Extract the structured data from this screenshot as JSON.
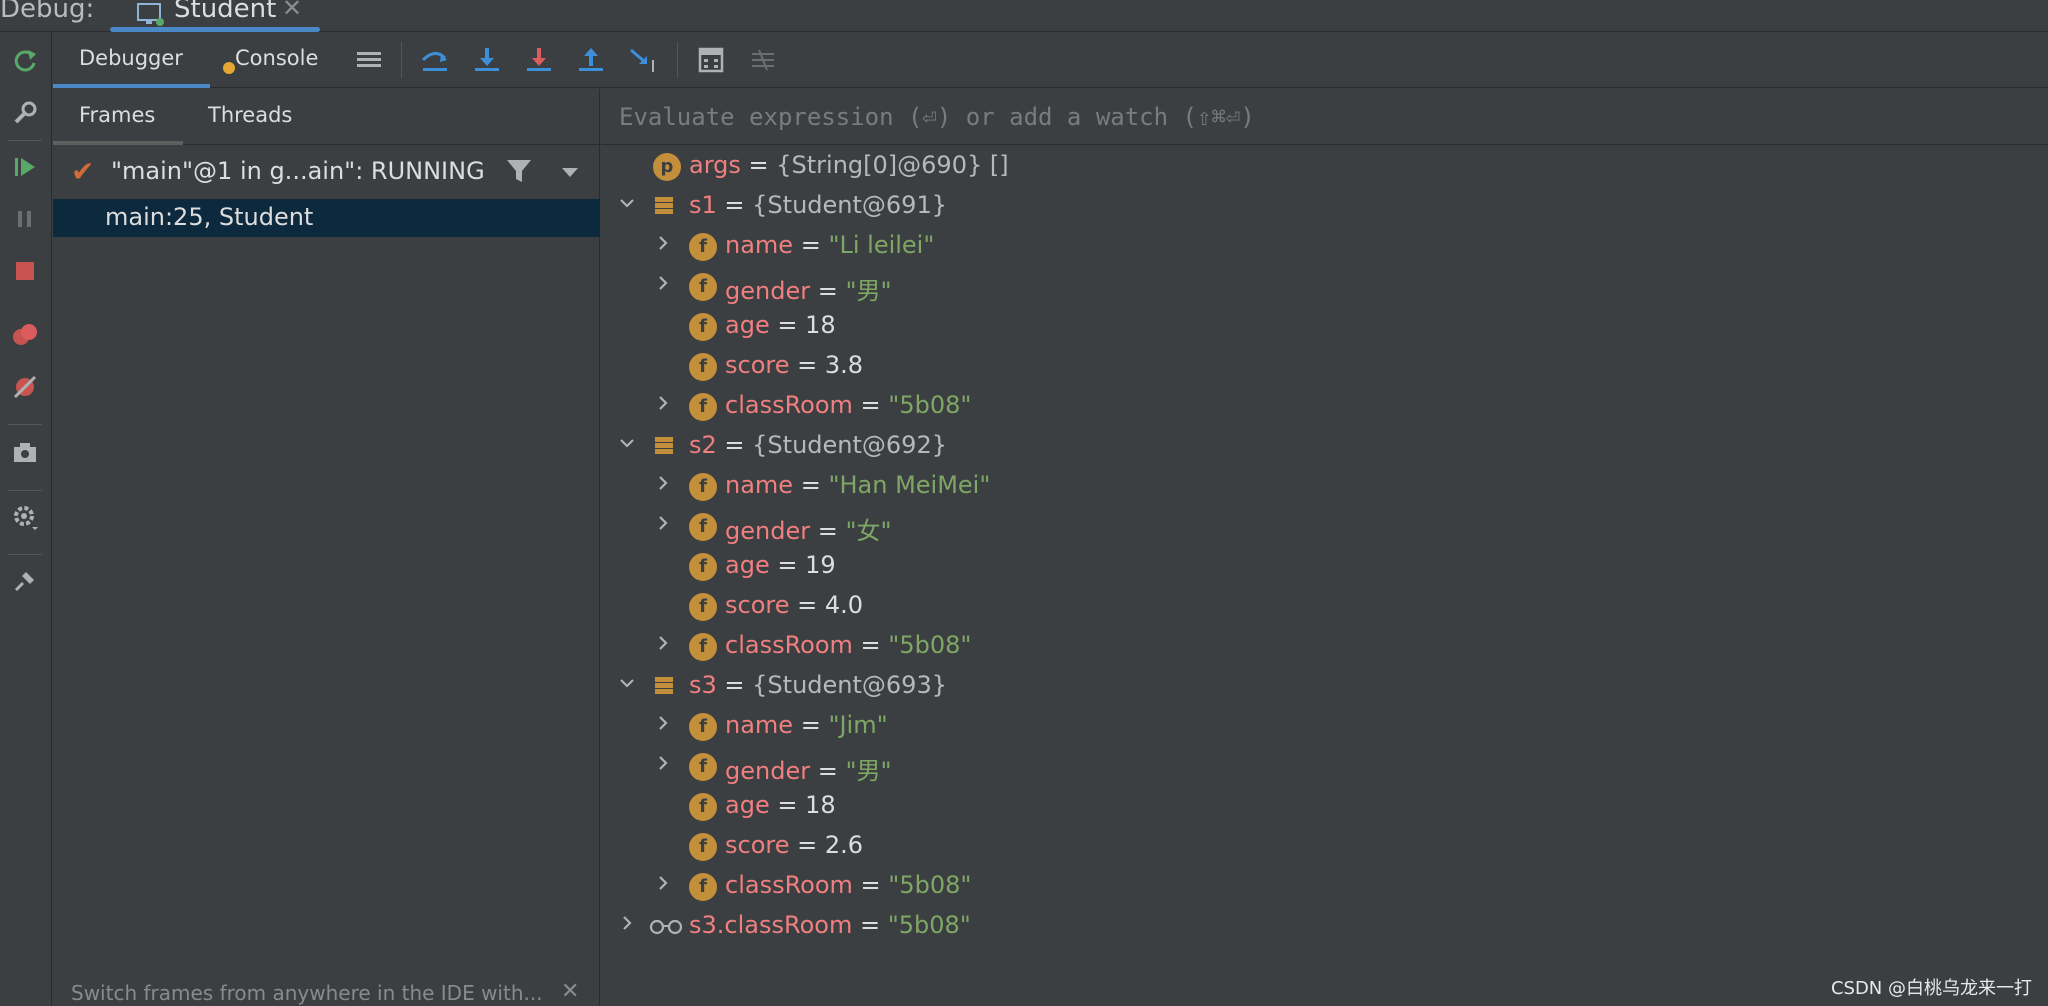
{
  "titlebar": {
    "label": "Debug:",
    "tab_name": "Student",
    "tab_close": "✕"
  },
  "tabstrip": {
    "debugger_label": "Debugger",
    "console_label": "Console"
  },
  "frames": {
    "tabs": [
      "Frames",
      "Threads"
    ],
    "thread_text": "\"main\"@1 in g...ain\": RUNNING",
    "frame": "main:25, Student",
    "hint": "Switch frames from anywhere in the IDE with...",
    "hint_close": "✕"
  },
  "eval": {
    "placeholder": "Evaluate expression (⏎) or add a watch (⇧⌘⏎)"
  },
  "variables": [
    {
      "name": "args",
      "value": "{String[0]@690} []",
      "kind": "param",
      "badge": "p"
    },
    {
      "name": "s1",
      "value": "{Student@691}",
      "kind": "object"
    },
    {
      "name": "name",
      "value": "\"Li leilei\"",
      "kind": "field",
      "badge": "f"
    },
    {
      "name": "gender",
      "value": "\"男\"",
      "kind": "field",
      "badge": "f"
    },
    {
      "name": "age",
      "value": "18",
      "kind": "field",
      "badge": "f"
    },
    {
      "name": "score",
      "value": "3.8",
      "kind": "field",
      "badge": "f"
    },
    {
      "name": "classRoom",
      "value": "\"5b08\"",
      "kind": "field",
      "badge": "f"
    },
    {
      "name": "s2",
      "value": "{Student@692}",
      "kind": "object"
    },
    {
      "name": "name",
      "value": "\"Han MeiMei\"",
      "kind": "field",
      "badge": "f"
    },
    {
      "name": "gender",
      "value": "\"女\"",
      "kind": "field",
      "badge": "f"
    },
    {
      "name": "age",
      "value": "19",
      "kind": "field",
      "badge": "f"
    },
    {
      "name": "score",
      "value": "4.0",
      "kind": "field",
      "badge": "f"
    },
    {
      "name": "classRoom",
      "value": "\"5b08\"",
      "kind": "field",
      "badge": "f"
    },
    {
      "name": "s3",
      "value": "{Student@693}",
      "kind": "object"
    },
    {
      "name": "name",
      "value": "\"Jim\"",
      "kind": "field",
      "badge": "f"
    },
    {
      "name": "gender",
      "value": "\"男\"",
      "kind": "field",
      "badge": "f"
    },
    {
      "name": "age",
      "value": "18",
      "kind": "field",
      "badge": "f"
    },
    {
      "name": "score",
      "value": "2.6",
      "kind": "field",
      "badge": "f"
    },
    {
      "name": "classRoom",
      "value": "\"5b08\"",
      "kind": "field",
      "badge": "f"
    },
    {
      "name": "s3.classRoom",
      "value": "\"5b08\"",
      "kind": "watch"
    }
  ],
  "watermark": "CSDN @白桃乌龙来一打",
  "colors": {
    "accent": "#4a88c7",
    "selection": "#0d293e",
    "var_name": "#f07f7f",
    "string": "#7ea765",
    "badge": "#c48f3b"
  }
}
